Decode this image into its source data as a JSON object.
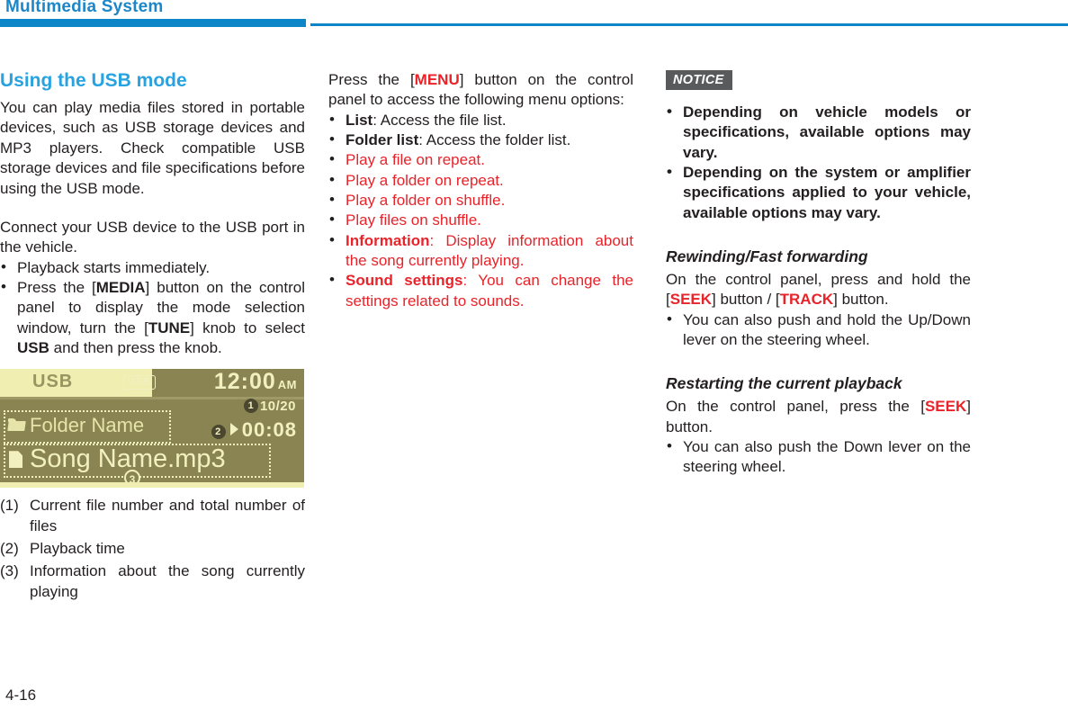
{
  "header": {
    "title": "Multimedia System",
    "accent_color": "#0d86c8"
  },
  "footer": {
    "page_number": "4-16"
  },
  "colors": {
    "heading_blue": "#29a3e0",
    "red": "#e8232a",
    "notice_gray": "#595a5c",
    "display_bg": "#8a8452",
    "display_text": "#f2f0c0"
  },
  "column1": {
    "heading": "Using the USB mode",
    "paragraph1_parts": [
      "You can play media files stored in portable devices, such as USB storage devices and MP3 players. Check compatible USB storage devices and file specifications before using the USB mode."
    ],
    "paragraph2": "Connect your USB device to the USB port in the vehicle.",
    "bullets": [
      {
        "prefix": "Playback starts immediately.",
        "parts": []
      },
      {
        "prefix": "Press the [",
        "bold1": "MEDIA",
        "mid1": "] button on the control panel to display the mode selection window, turn the [",
        "bold2": "TUNE",
        "mid2": "] knob to select ",
        "bold3": "USB",
        "suffix": " and then press the knob."
      }
    ],
    "display": {
      "mode_label": "USB",
      "usb_chip_label": "USB",
      "clock": "12:00",
      "clock_ampm": "AM",
      "marker1": "1",
      "track_count": "10/20",
      "marker2": "2",
      "play_time": "00:08",
      "folder_name": "Folder Name",
      "song_name": "Song Name.mp3",
      "marker3": "3"
    },
    "numbered_list": [
      {
        "num": "(1)",
        "text": "Current file number and total number of files"
      },
      {
        "num": "(2)",
        "text": "Playback time"
      },
      {
        "num": "(3)",
        "text": "Information about the song currently playing"
      }
    ]
  },
  "column2": {
    "intro_prefix": "Press the [",
    "intro_key": "MENU",
    "intro_suffix": "] button on the control panel to access the following menu options:",
    "menu_bullets": [
      {
        "label": "List",
        "label_style": "bold-black",
        "text": ": Access the file list.",
        "text_style": "black"
      },
      {
        "label": "Folder list",
        "label_style": "bold-black",
        "text": ": Access the folder list.",
        "text_style": "black"
      },
      {
        "label": "",
        "label_style": "none",
        "text": "Play a file on repeat.",
        "text_style": "red"
      },
      {
        "label": "",
        "label_style": "none",
        "text": "Play a folder on repeat.",
        "text_style": "red"
      },
      {
        "label": "",
        "label_style": "none",
        "text": "Play a folder on shuffle.",
        "text_style": "red"
      },
      {
        "label": "",
        "label_style": "none",
        "text": "Play files on shuffle.",
        "text_style": "red"
      },
      {
        "label": "Information",
        "label_style": "bold-red",
        "text": ": Display information about the song currently playing.",
        "text_style": "red"
      },
      {
        "label": "Sound settings",
        "label_style": "bold-red",
        "text": ": You can change the settings related to sounds.",
        "text_style": "red"
      }
    ]
  },
  "column3": {
    "notice_badge": "NOTICE",
    "notice_bullets": [
      "Depending on vehicle models or specifications, available options may vary.",
      "Depending on the system or amplifier specifications applied to your vehicle, available options may vary."
    ],
    "section1": {
      "heading": "Rewinding/Fast forwarding",
      "body_prefix": "On the control panel, press and hold the [",
      "body_key1": "SEEK",
      "body_mid": "] button / [",
      "body_key2": "TRACK",
      "body_suffix": "] button.",
      "bullet": "You can also push and hold the Up/Down lever on the steering wheel."
    },
    "section2": {
      "heading": "Restarting the current playback",
      "body_prefix": "On the control panel, press the [",
      "body_key1": "SEEK",
      "body_suffix": "] button.",
      "bullet": "You can also push the Down lever on the steering wheel."
    }
  }
}
